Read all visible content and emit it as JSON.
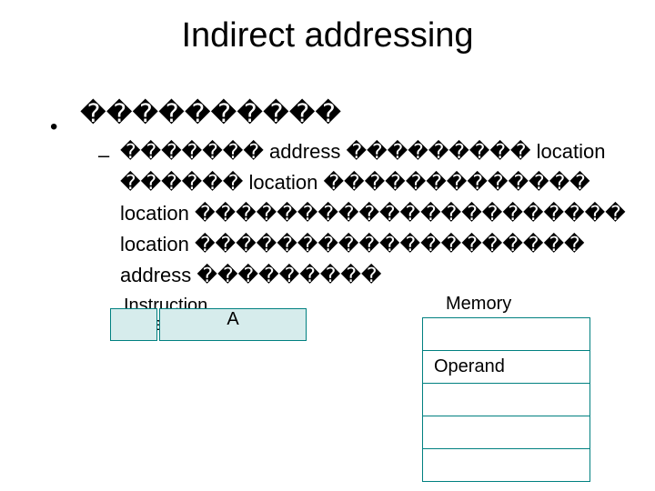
{
  "title": "Indirect addressing",
  "bullet1": "����������",
  "dash": "–",
  "body": {
    "line1_a": "�������",
    "line1_mid": "address",
    "line1_b": "���������",
    "line1_end": "location",
    "line2_a": "������",
    "line2_mid": "location",
    "line2_b": "�������������",
    "line3_a": "location",
    "line3_b": "���������������������",
    "line4_a": "location",
    "line4_b": "�������������������",
    "line5_a": "address",
    "line5_b": "���������"
  },
  "diagram": {
    "instruction_label": "Instruction",
    "address_label": "address",
    "address_field": "A",
    "memory_label": "Memory",
    "memory_rows": [
      "",
      "Operand",
      "",
      "",
      ""
    ]
  }
}
